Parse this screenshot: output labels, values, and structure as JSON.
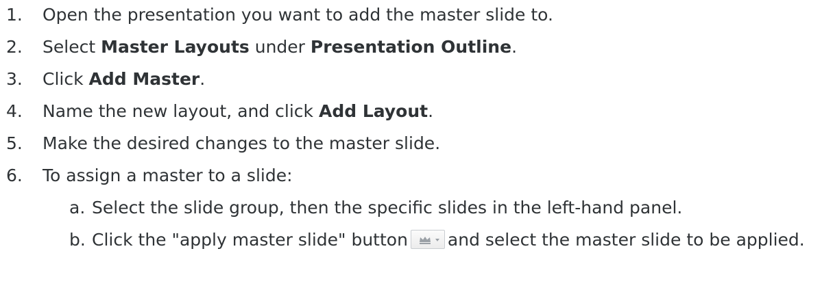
{
  "steps": [
    {
      "num": "1.",
      "parts": [
        {
          "t": "Open the presentation you want to add the master slide to.",
          "b": false
        }
      ]
    },
    {
      "num": "2.",
      "parts": [
        {
          "t": "Select ",
          "b": false
        },
        {
          "t": "Master Layouts",
          "b": true
        },
        {
          "t": " under ",
          "b": false
        },
        {
          "t": "Presentation Outline",
          "b": true
        },
        {
          "t": ".",
          "b": false
        }
      ]
    },
    {
      "num": "3.",
      "parts": [
        {
          "t": "Click ",
          "b": false
        },
        {
          "t": "Add Master",
          "b": true
        },
        {
          "t": ".",
          "b": false
        }
      ]
    },
    {
      "num": "4.",
      "parts": [
        {
          "t": "Name the new layout, and click ",
          "b": false
        },
        {
          "t": "Add Layout",
          "b": true
        },
        {
          "t": ".",
          "b": false
        }
      ]
    },
    {
      "num": "5.",
      "parts": [
        {
          "t": "Make the desired changes to the master slide.",
          "b": false
        }
      ]
    },
    {
      "num": "6.",
      "parts": [
        {
          "t": "To assign a master to a slide:",
          "b": false
        }
      ]
    }
  ],
  "substeps": {
    "a": {
      "letter": "a.",
      "text": "Select the slide group, then the specific slides in the left-hand panel."
    },
    "b": {
      "letter": "b.",
      "before": "Click the \"apply master slide\" button",
      "after": "and select the master slide to be applied."
    }
  },
  "icons": {
    "apply_master_button": "crown-dropdown-icon"
  },
  "colors": {
    "text": "#2f3336",
    "button_icon": "#9aa0a6"
  }
}
